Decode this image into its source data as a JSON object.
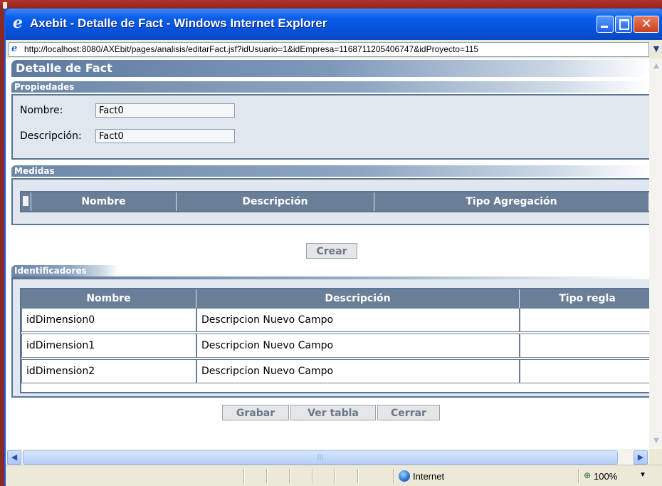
{
  "window": {
    "title": "Axebit - Detalle de Fact - Windows Internet Explorer",
    "url": "http://localhost:8080/AXEbit/pages/analisis/editarFact.jsf?idUsuario=1&idEmpresa=1168711205406747&idProyecto=115"
  },
  "page": {
    "title": "Detalle de Fact"
  },
  "propiedades": {
    "header": "Propiedades",
    "nombre_label": "Nombre:",
    "nombre_value": "Fact0",
    "descripcion_label": "Descripción:",
    "descripcion_value": "Fact0"
  },
  "medidas": {
    "header": "Medidas",
    "columns": [
      "Nombre",
      "Descripción",
      "Tipo Agregación"
    ],
    "create_button": "Crear"
  },
  "identificadores": {
    "header": "Identificadores",
    "columns": [
      "Nombre",
      "Descripción",
      "Tipo regla"
    ],
    "rows": [
      {
        "nombre": "idDimension0",
        "descripcion": "Descripcion Nuevo Campo",
        "tipo": ""
      },
      {
        "nombre": "idDimension1",
        "descripcion": "Descripcion Nuevo Campo",
        "tipo": ""
      },
      {
        "nombre": "idDimension2",
        "descripcion": "Descripcion Nuevo Campo",
        "tipo": ""
      }
    ]
  },
  "actions": {
    "save": "Grabar",
    "view_table": "Ver tabla",
    "close": "Cerrar"
  },
  "status": {
    "zone": "Internet",
    "zoom": "100%"
  }
}
